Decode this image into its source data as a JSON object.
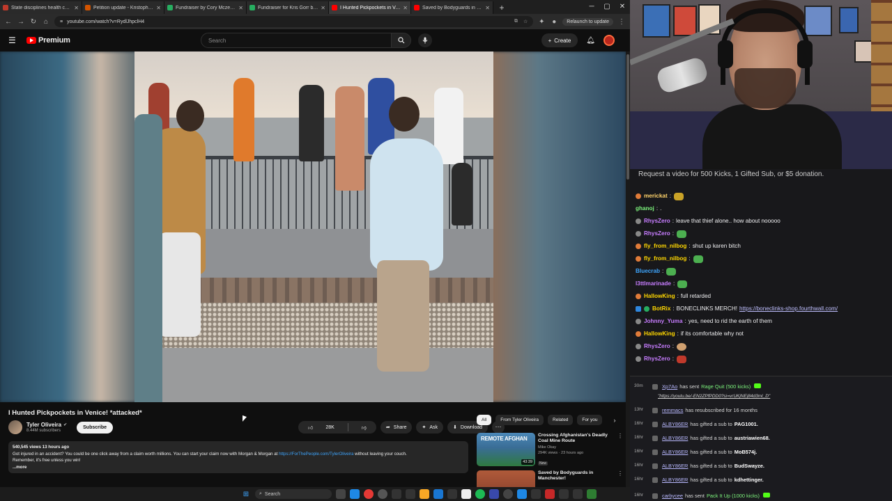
{
  "browser": {
    "tabs": [
      {
        "label": "State disciplines health care pr...",
        "active": false,
        "color": "#c0392b"
      },
      {
        "label": "Petition update - Kristopher's ...",
        "active": false,
        "color": "#d35400"
      },
      {
        "label": "Fundraiser by Cory Mczenna...",
        "active": false,
        "color": "#27ae60"
      },
      {
        "label": "Fundraiser for Kris Gorr by Ke...",
        "active": false,
        "color": "#27ae60"
      },
      {
        "label": "I Hunted Pickpockets in Ve...",
        "active": true,
        "color": "#ff0000"
      },
      {
        "label": "Saved by Bodyguards in Manc...",
        "active": false,
        "color": "#ff0000"
      }
    ],
    "url": "youtube.com/watch?v=RydlJhpclH4",
    "relaunch_label": "Relaunch to update"
  },
  "youtube": {
    "logo_text": "Premium",
    "search_placeholder": "Search",
    "create_label": "Create",
    "video_title": "I Hunted Pickpockets in Venice! *attacked*",
    "channel_name": "Tyler Oliveira",
    "channel_subs": "8.44M subscribers",
    "subscribe_label": "Subscribe",
    "likes": "28K",
    "share_label": "Share",
    "ask_label": "Ask",
    "download_label": "Download",
    "description": {
      "stats": "540,545 views  13 hours ago",
      "text1": "Got injured in an accident? You could be one click away from a claim worth millions. You can start your claim now with Morgan & Morgan at",
      "link": "https://ForThePeople.com/TylerOliveira",
      "text2": "without leaving your couch.",
      "text3": "Remember, it's free unless you win!",
      "more": "...more"
    },
    "chips": [
      "All",
      "From Tyler Oliveira",
      "Related",
      "For you"
    ],
    "recommendations": [
      {
        "title": "Crossing Afghanistan's Deadly Coal Mine Route",
        "channel": "Mike Okay",
        "meta": "294K views · 23 hours ago",
        "badge": "New",
        "duration": "43:39",
        "thumb_text": "REMOTE AFGHAN"
      },
      {
        "title": "Saved by Bodyguards in Manchester!",
        "channel": "",
        "meta": "",
        "badge": "",
        "duration": "",
        "thumb_text": ""
      }
    ]
  },
  "taskbar": {
    "search_label": "Search"
  },
  "chat": {
    "banner": "Request a video for 500 Kicks, 1 Gifted Sub, or $5 donation.",
    "messages": [
      {
        "user": "merickat",
        "user_color": "#ffd36b",
        "text": "",
        "emote": "#c9a227",
        "badge": "#e07b39"
      },
      {
        "user": "ghanoj",
        "user_color": "#7cf37c",
        "text": ".",
        "emote": "",
        "badge": ""
      },
      {
        "user": "RhysZero",
        "user_color": "#c77dff",
        "text": "leave that thief alone.. how about nooooo",
        "emote": "",
        "badge": "#888"
      },
      {
        "user": "RhysZero",
        "user_color": "#c77dff",
        "text": "",
        "emote": "#4caf50",
        "badge": "#888"
      },
      {
        "user": "fly_from_nilbog",
        "user_color": "#ffd700",
        "text": "shut up karen bitch",
        "emote": "",
        "badge": "#e07b39"
      },
      {
        "user": "fly_from_nilbog",
        "user_color": "#ffd700",
        "text": "",
        "emote": "#4caf50",
        "badge": "#e07b39"
      },
      {
        "user": "Bluecrab",
        "user_color": "#3ea6ff",
        "text": "",
        "emote": "#4caf50",
        "badge": ""
      },
      {
        "user": "l3ttlmarinade",
        "user_color": "#c77dff",
        "text": "",
        "emote": "#4caf50",
        "badge": ""
      },
      {
        "user": "HallowKing",
        "user_color": "#ffd700",
        "text": "full retarded",
        "emote": "",
        "badge": "#e07b39"
      },
      {
        "user": "BotRix",
        "user_color": "#ffd700",
        "text": "BONECLINKS MERCH!",
        "link": "https://boneclinks-shop.fourthwall.com/",
        "emote": "",
        "badge": "#2e86de"
      },
      {
        "user": "Johnny_Yuma",
        "user_color": "#c77dff",
        "text": "yes, need to rid the earth of them",
        "emote": "",
        "badge": "#888"
      },
      {
        "user": "HallowKing",
        "user_color": "#ffd700",
        "text": "if its comfortable why not",
        "emote": "",
        "badge": "#e07b39"
      },
      {
        "user": "RhysZero",
        "user_color": "#c77dff",
        "text": "",
        "emote": "#d0a070",
        "badge": "#888"
      },
      {
        "user": "RhysZero",
        "user_color": "#c77dff",
        "text": "",
        "emote": "#c0392b",
        "badge": "#888"
      }
    ]
  },
  "feed": [
    {
      "time": "30m",
      "user": "Xp7Ao",
      "pre": "has sent",
      "highlight": "Rage Quit (500 kicks)",
      "post": ""
    },
    {
      "time": "13hr",
      "user": "remmacs",
      "pre": "has resubscribed for 16 months",
      "highlight": "",
      "post": ""
    },
    {
      "time": "16hr",
      "user": "ALBY86ER",
      "pre": "has gifted a sub to",
      "highlight": "",
      "post": "PAG1001."
    },
    {
      "time": "16hr",
      "user": "ALBY86ER",
      "pre": "has gifted a sub to",
      "highlight": "",
      "post": "austriawien68."
    },
    {
      "time": "16hr",
      "user": "ALBY86ER",
      "pre": "has gifted a sub to",
      "highlight": "",
      "post": "MoB574j."
    },
    {
      "time": "16hr",
      "user": "ALBY86ER",
      "pre": "has gifted a sub to",
      "highlight": "",
      "post": "BudSwayze."
    },
    {
      "time": "16hr",
      "user": "ALBY86ER",
      "pre": "has gifted a sub to",
      "highlight": "",
      "post": "kdhettinger."
    },
    {
      "time": "16hr",
      "user": "carbycee",
      "pre": "has sent",
      "highlight": "Pack It Up (1000 kicks)",
      "post": ""
    }
  ],
  "feed_link": "\"https://youtu.be/-EN2ZPfPDD0?si=vrUKjNEj84d3ml_D\""
}
